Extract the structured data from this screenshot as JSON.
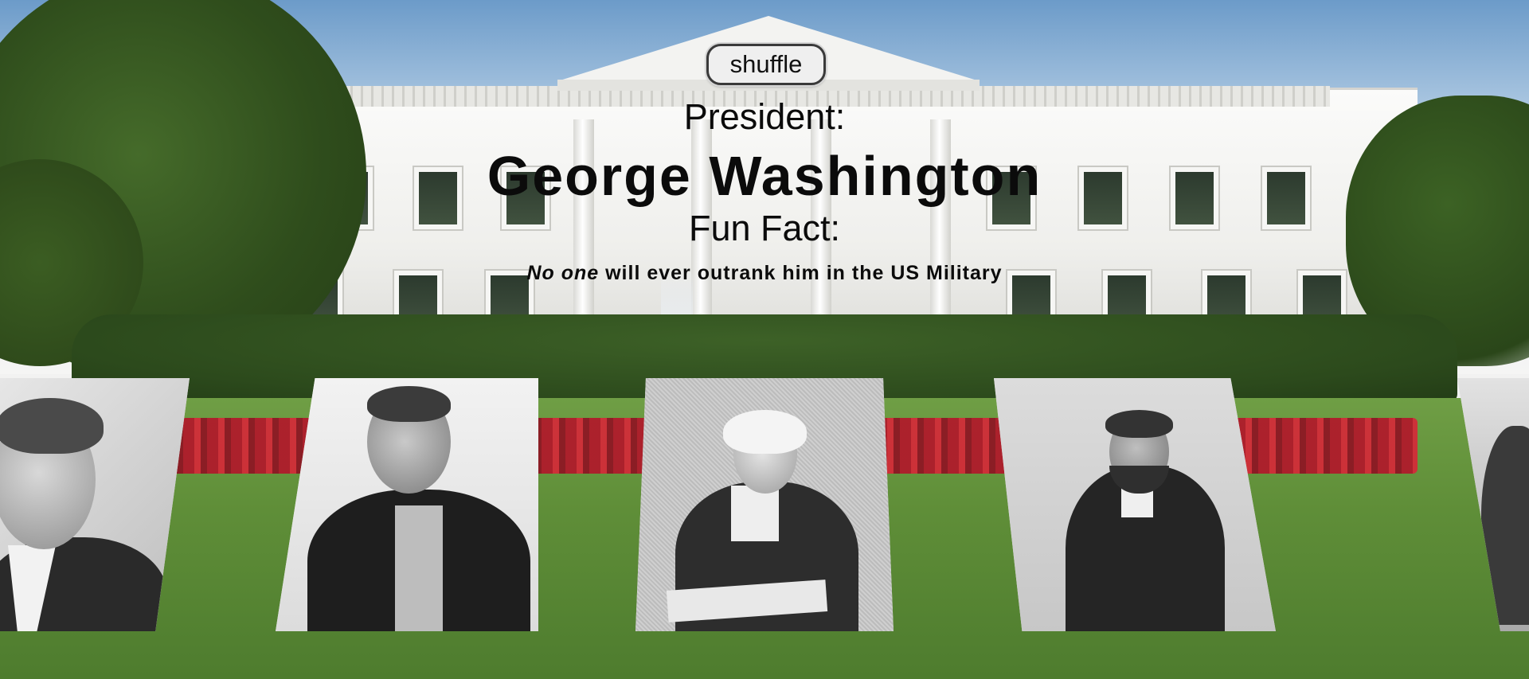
{
  "toolbar": {
    "shuffle_label": "shuffle"
  },
  "president": {
    "label": "President:",
    "name": "George Washington"
  },
  "fun_fact": {
    "label": "Fun Fact:",
    "text_italic": "No one",
    "text_rest": " will ever outrank him in the US Military"
  },
  "carousel": {
    "portraits": [
      {
        "subject": "kennedy-portrait"
      },
      {
        "subject": "roosevelt-portrait"
      },
      {
        "subject": "washington-portrait"
      },
      {
        "subject": "lincoln-portrait"
      },
      {
        "subject": "partial-portrait"
      }
    ]
  },
  "colors": {
    "text": "#0b0b0b",
    "button_bg": "#efefef",
    "button_border": "#3a3a3a"
  }
}
